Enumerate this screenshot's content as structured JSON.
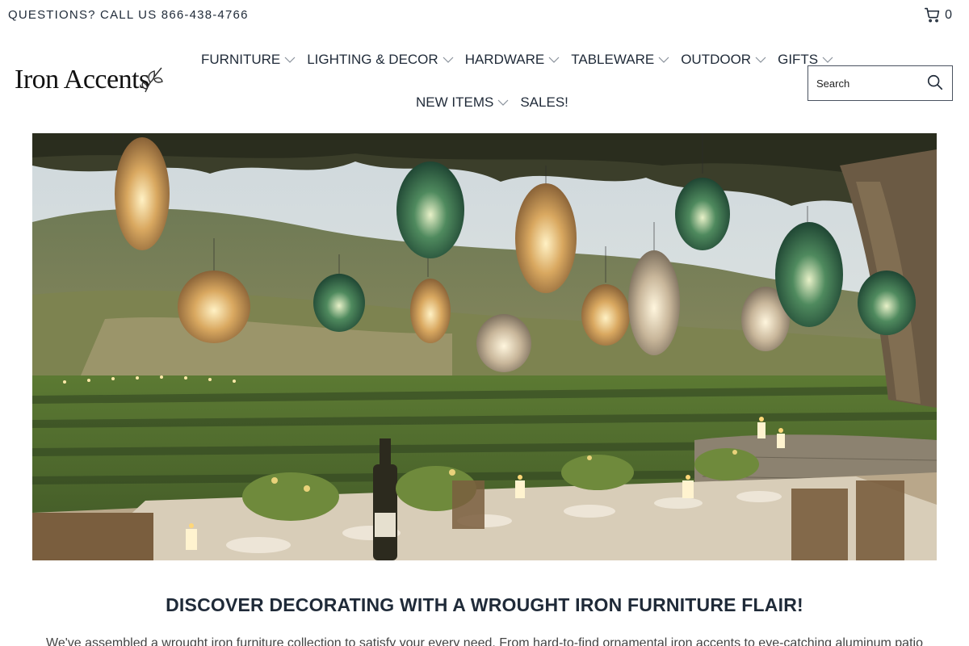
{
  "topbar": {
    "phone_text": "QUESTIONS? CALL US 866-438-4766",
    "cart_count": "0",
    "cart_icon": "shopping-cart-icon"
  },
  "logo": {
    "text": "Iron Accents",
    "icon": "leaf-flourish-icon"
  },
  "nav": {
    "items": [
      {
        "label": "FURNITURE",
        "has_dropdown": true
      },
      {
        "label": "LIGHTING & DECOR",
        "has_dropdown": true
      },
      {
        "label": "HARDWARE",
        "has_dropdown": true
      },
      {
        "label": "TABLEWARE",
        "has_dropdown": true
      },
      {
        "label": "OUTDOOR",
        "has_dropdown": true
      },
      {
        "label": "GIFTS",
        "has_dropdown": true
      },
      {
        "label": "NEW ITEMS",
        "has_dropdown": true
      },
      {
        "label": "SALES!",
        "has_dropdown": false
      }
    ],
    "dropdown_icon": "chevron-down-icon"
  },
  "search": {
    "placeholder": "Search",
    "icon": "search-icon"
  },
  "hero": {
    "alt": ""
  },
  "content": {
    "headline": "DISCOVER DECORATING WITH A WROUGHT IRON FURNITURE FLAIR!",
    "intro": "We've assembled a wrought iron furniture collection to satisfy your every need. From hard-to-find ornamental iron accents to eye-catching aluminum patio"
  },
  "colors": {
    "text": "#1f2a38",
    "border": "#4a5360",
    "background": "#ffffff"
  }
}
